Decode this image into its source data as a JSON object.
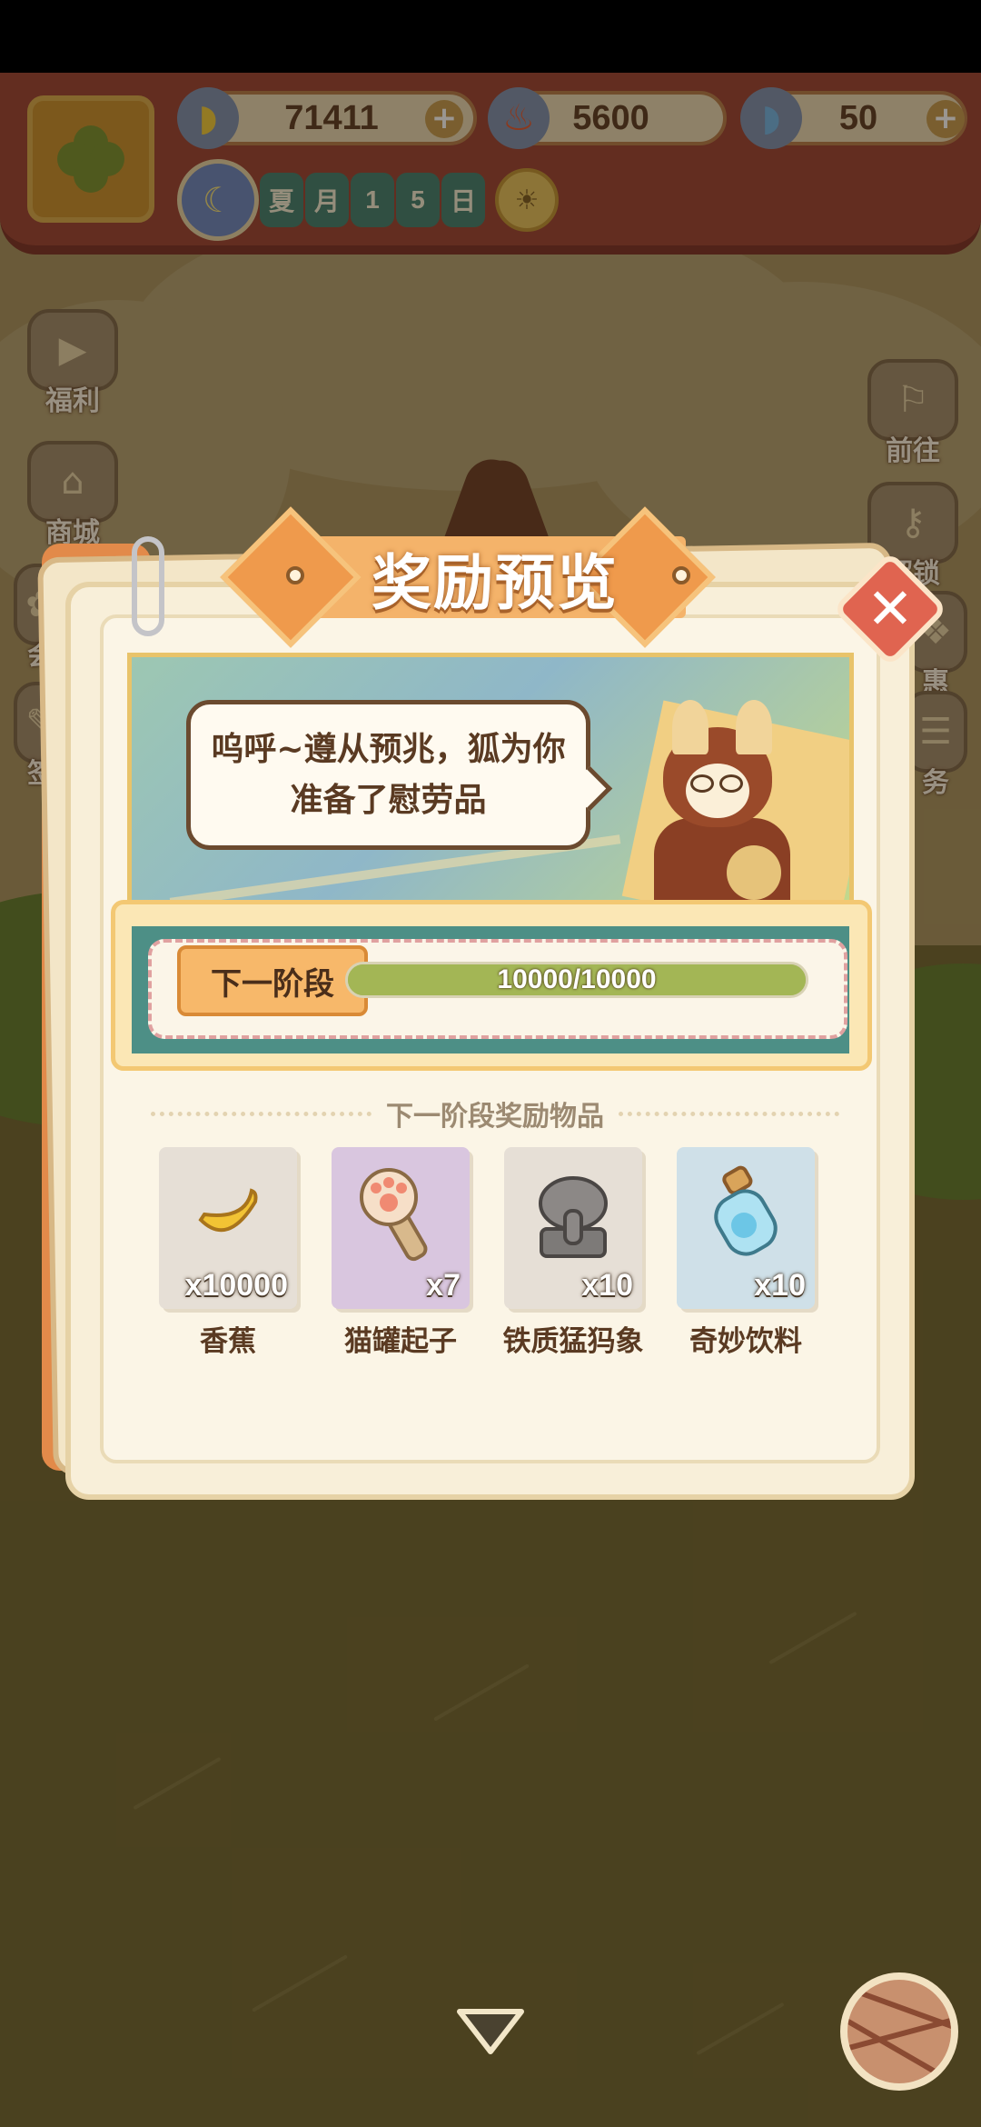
{
  "hud": {
    "bananas": "71411",
    "chili": "5600",
    "gems": "50",
    "date_chars": [
      "夏",
      "月",
      "1",
      "5",
      "日"
    ]
  },
  "side_left": [
    {
      "label": "福利",
      "icon": "tv-icon"
    },
    {
      "label": "商城",
      "icon": "shop-icon"
    },
    {
      "label": "会",
      "icon": "event-icon"
    },
    {
      "label": "签",
      "icon": "signin-icon"
    }
  ],
  "side_right": [
    {
      "label": "前往",
      "icon": "signboard-icon"
    },
    {
      "label": "解锁",
      "icon": "key-icon"
    },
    {
      "label": "惠",
      "icon": "gift-icon"
    },
    {
      "label": "务",
      "icon": "task-icon"
    }
  ],
  "modal": {
    "title": "奖励预览",
    "speech": "呜呼~遵从预兆，狐为你准备了慰劳品",
    "stage_label": "下一阶段",
    "progress_text": "10000/10000",
    "progress_fraction": 1.0,
    "section_title": "下一阶段奖励物品",
    "items": [
      {
        "name": "香蕉",
        "qty": "x10000",
        "icon": "banana-icon",
        "bg": "#e6dfd6"
      },
      {
        "name": "猫罐起子",
        "qty": "x7",
        "icon": "cat-paw-opener-icon",
        "bg": "#d9c6df"
      },
      {
        "name": "铁质猛犸象",
        "qty": "x10",
        "icon": "iron-mammoth-icon",
        "bg": "#e6dfd6"
      },
      {
        "name": "奇妙饮料",
        "qty": "x10",
        "icon": "potion-bottle-icon",
        "bg": "#cfe0e8"
      }
    ]
  },
  "colors": {
    "accent_orange": "#ef9a4c",
    "close_red": "#e06450",
    "progress_green": "#a3b655",
    "hud_red": "#9b4032"
  }
}
